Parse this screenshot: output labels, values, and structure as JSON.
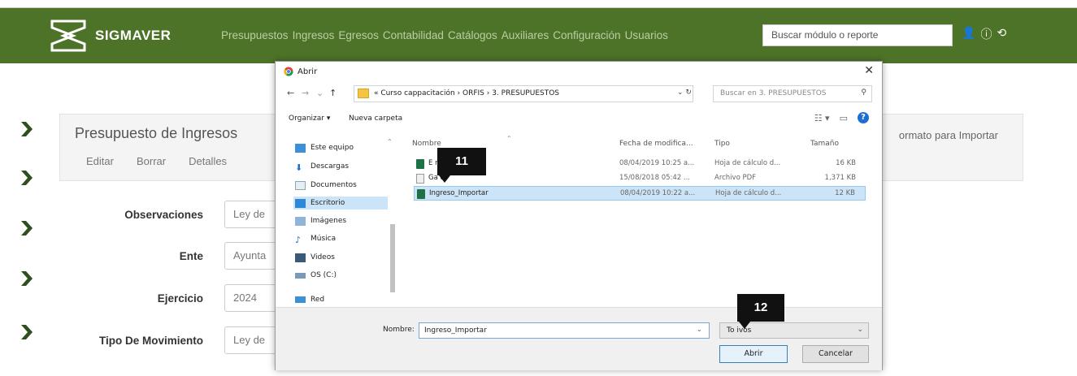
{
  "navbar": {
    "brand": "SIGMAVER",
    "links": [
      "Presupuestos",
      "Ingresos",
      "Egresos",
      "Contabilidad",
      "Catálogos",
      "Auxiliares",
      "Configuración",
      "Usuarios"
    ],
    "search_placeholder": "Buscar módulo o reporte",
    "icons": [
      "user-icon",
      "info-icon",
      "logout-icon"
    ],
    "color": "#4d7328"
  },
  "panel": {
    "title": "Presupuesto de Ingresos",
    "links": [
      "Editar",
      "Borrar",
      "Detalles"
    ],
    "right_link": "ormato para Importar"
  },
  "form": {
    "fields": [
      {
        "label": "Observaciones",
        "value": "Ley de"
      },
      {
        "label": "Ente",
        "value": "Ayunta"
      },
      {
        "label": "Ejercicio",
        "value": "2024"
      },
      {
        "label": "Tipo De Movimiento",
        "value": "Ley de"
      }
    ]
  },
  "dialog": {
    "title": "Abrir",
    "path": "« Curso cappacitación  ›  ORFIS  ›  3. PRESUPUESTOS",
    "search_placeholder": "Buscar en 3. PRESUPUESTOS",
    "organize": "Organizar ▾",
    "new_folder": "Nueva carpeta",
    "nav_items": [
      {
        "label": "Este equipo",
        "icon": "computer-icon"
      },
      {
        "label": "Descargas",
        "icon": "downloads-icon"
      },
      {
        "label": "Documentos",
        "icon": "documents-icon"
      },
      {
        "label": "Escritorio",
        "icon": "desktop-icon",
        "selected": true
      },
      {
        "label": "Imágenes",
        "icon": "pictures-icon"
      },
      {
        "label": "Música",
        "icon": "music-icon"
      },
      {
        "label": "Videos",
        "icon": "videos-icon"
      },
      {
        "label": "OS (C:)",
        "icon": "drive-icon"
      },
      {
        "label": "Red",
        "icon": "network-icon"
      }
    ],
    "columns": [
      "Nombre",
      "Fecha de modifica...",
      "Tipo",
      "Tamaño"
    ],
    "files": [
      {
        "name": "E          rtar",
        "date": "08/04/2019 10:25 a...",
        "type": "Hoja de cálculo d...",
        "size": "16 KB",
        "icon": "excel-icon"
      },
      {
        "name": "Ga        o",
        "date": "15/08/2018 05:42 ...",
        "type": "Archivo PDF",
        "size": "1,371 KB",
        "icon": "pdf-icon"
      },
      {
        "name": "Ingreso_Importar",
        "date": "08/04/2019 10:22 a...",
        "type": "Hoja de cálculo d...",
        "size": "12 KB",
        "icon": "excel-icon",
        "selected": true
      }
    ],
    "name_label": "Nombre:",
    "name_value": "Ingreso_Importar",
    "filter_value": "To          ivos",
    "open_button": "Abrir",
    "cancel_button": "Cancelar"
  },
  "markers": [
    "11",
    "12"
  ]
}
